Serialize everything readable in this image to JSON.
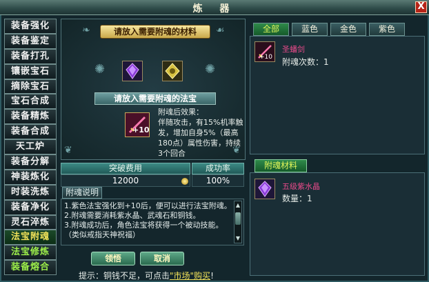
{
  "window": {
    "title": "炼 器",
    "close_label": "X"
  },
  "menu": [
    {
      "label": "装备强化"
    },
    {
      "label": "装备鉴定"
    },
    {
      "label": "装备打孔"
    },
    {
      "label": "镶嵌宝石"
    },
    {
      "label": "摘除宝石"
    },
    {
      "label": "宝石合成"
    },
    {
      "label": "装备精炼"
    },
    {
      "label": "装备合成"
    },
    {
      "label": "天工炉"
    },
    {
      "label": "装备分解"
    },
    {
      "label": "神装炼化"
    },
    {
      "label": "时装洗炼"
    },
    {
      "label": "装备净化"
    },
    {
      "label": "灵石淬炼"
    },
    {
      "label": "法宝附魂"
    },
    {
      "label": "法宝修炼"
    },
    {
      "label": "装备熔合"
    }
  ],
  "center": {
    "material_banner": "请放入需要附魂的材料",
    "treasure_banner": "请放入需要附魂的法宝",
    "result_level": "+10",
    "effect_title": "附魂后效果：",
    "effect_text": "伴随攻击，有15%机率触发，增加自身5%（最高180点）属性伤害，持续3个回合"
  },
  "table": {
    "cost_header": "突破费用",
    "rate_header": "成功率",
    "cost_value": "12000",
    "rate_value": "100%"
  },
  "description": {
    "tab_label": "附魂说明",
    "lines": [
      "1.紫色法宝强化到+10后，便可以进行法宝附魂。",
      "2.附魂需要消耗紫水晶、武魂石和铜钱。",
      "3.附魂成功后，角色法宝将获得一个被动技能。（类似戒指天神祝福）"
    ]
  },
  "buttons": {
    "confirm": "领悟",
    "cancel": "取消"
  },
  "hint": {
    "prefix": "提示：铜钱不足，可点击",
    "link": "\"市场\"购买",
    "suffix": "!"
  },
  "right": {
    "tabs": [
      {
        "label": "全部"
      },
      {
        "label": "蓝色"
      },
      {
        "label": "金色"
      },
      {
        "label": "紫色"
      }
    ],
    "treasure_item": {
      "name": "圣蟠剑",
      "level": "+10",
      "info": "附魂次数：1"
    },
    "material_tab": "附魂材料",
    "material_item": {
      "name": "五级紫水晶",
      "info": "数量：1"
    }
  }
}
